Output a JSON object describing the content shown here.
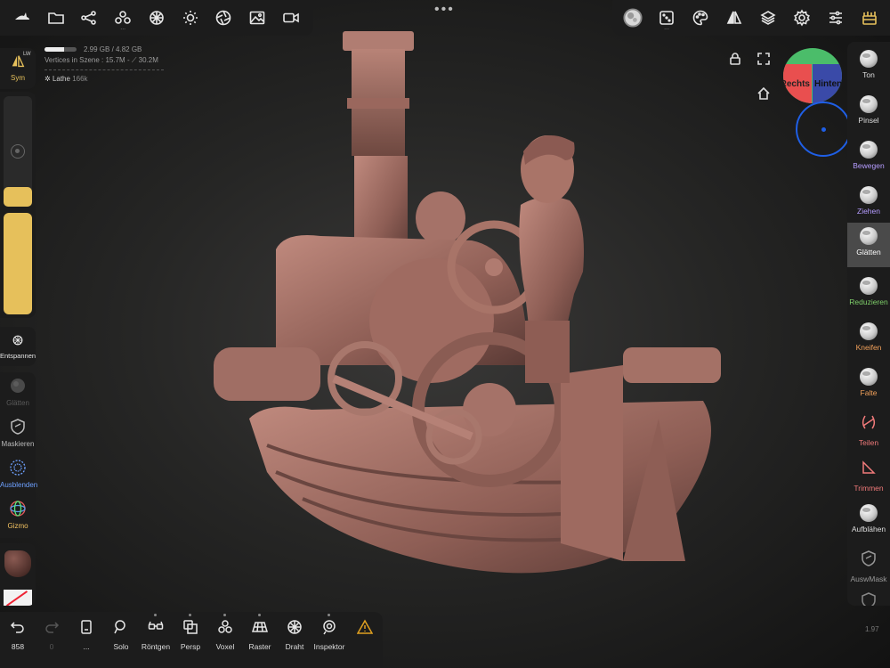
{
  "top_bar_left": {
    "items": [
      {
        "icon": "shark-logo-icon"
      },
      {
        "icon": "folder-icon"
      },
      {
        "icon": "scene-graph-icon"
      },
      {
        "icon": "primitives-icon",
        "more": "..."
      },
      {
        "icon": "topology-icon"
      },
      {
        "icon": "sun-icon"
      },
      {
        "icon": "aperture-icon"
      },
      {
        "icon": "image-icon"
      },
      {
        "icon": "video-icon"
      }
    ]
  },
  "center_menu": "•••",
  "top_bar_right": {
    "items": [
      {
        "icon": "brush-alpha-icon"
      },
      {
        "icon": "dice-icon",
        "more": "..."
      },
      {
        "icon": "palette-icon"
      },
      {
        "icon": "symmetry-icon"
      },
      {
        "icon": "layers-icon"
      },
      {
        "icon": "settings-icon"
      },
      {
        "icon": "sliders-icon"
      },
      {
        "icon": "toolbox-icon"
      }
    ]
  },
  "stats": {
    "memory": "2.99 GB / 4.82 GB",
    "memory_fraction": 0.62,
    "vertices": "Vertices in Szene : 15.7M - ⟋ 30.2M",
    "mesh_name": "Lathe",
    "mesh_count": "166k"
  },
  "left_panel": {
    "sym_label": "Sym",
    "sym_badge": "LW",
    "radius_level": 0.18,
    "intensity_level": 1.0,
    "relax_label": "Entspannen",
    "tools": [
      {
        "label": "Glätten",
        "icon": "smooth-icon",
        "color": "#5a5a5a"
      },
      {
        "label": "Maskieren",
        "icon": "mask-icon",
        "color": "#bbbbbb"
      },
      {
        "label": "Ausblenden",
        "icon": "hide-icon",
        "color": "#6ea1ff"
      },
      {
        "label": "Gizmo",
        "icon": "gizmo-icon",
        "color": "#f0c060"
      }
    ]
  },
  "right_tools": [
    {
      "label": "Ton",
      "color": "#dddddd",
      "icon": "clay-icon"
    },
    {
      "label": "Pinsel",
      "color": "#dddddd",
      "icon": "brush-icon"
    },
    {
      "label": "Bewegen",
      "color": "#b59cff",
      "icon": "move-icon"
    },
    {
      "label": "Ziehen",
      "color": "#b59cff",
      "icon": "drag-icon"
    },
    {
      "label": "Glätten",
      "color": "#ffffff",
      "icon": "smooth-icon",
      "active": true
    },
    {
      "label": "Reduzieren",
      "color": "#7fcf6a",
      "icon": "flatten-icon"
    },
    {
      "label": "Kneifen",
      "color": "#f3a25b",
      "icon": "pinch-icon"
    },
    {
      "label": "Falte",
      "color": "#f3a25b",
      "icon": "crease-icon"
    },
    {
      "label": "Teilen",
      "color": "#f07a7a",
      "icon": "split-icon"
    },
    {
      "label": "Trimmen",
      "color": "#f07a7a",
      "icon": "trim-icon"
    },
    {
      "label": "Aufblähen",
      "color": "#dddddd",
      "icon": "inflate-icon"
    },
    {
      "label": "AuswMask",
      "color": "#999999",
      "icon": "select-mask-icon"
    }
  ],
  "bottom_bar": {
    "undo_count": "858",
    "redo_count": "0",
    "items": [
      {
        "label": "...",
        "icon": "device-icon"
      },
      {
        "label": "Solo",
        "icon": "search-icon"
      },
      {
        "label": "Röntgen",
        "icon": "xray-glasses-icon"
      },
      {
        "label": "Persp",
        "icon": "perspective-icon"
      },
      {
        "label": "Voxel",
        "icon": "voxel-icon"
      },
      {
        "label": "Raster",
        "icon": "grid-icon"
      },
      {
        "label": "Draht",
        "icon": "wireframe-icon"
      },
      {
        "label": "Inspektor",
        "icon": "inspector-icon"
      }
    ],
    "warning_color": "#e0a020"
  },
  "viewport": {
    "gizmo_left": "Rechts",
    "gizmo_right": "Hinten"
  },
  "version": "1.97",
  "colors": {
    "accent": "#e6c05b",
    "panel": "#1c1c1c",
    "model": "#a06e64"
  }
}
